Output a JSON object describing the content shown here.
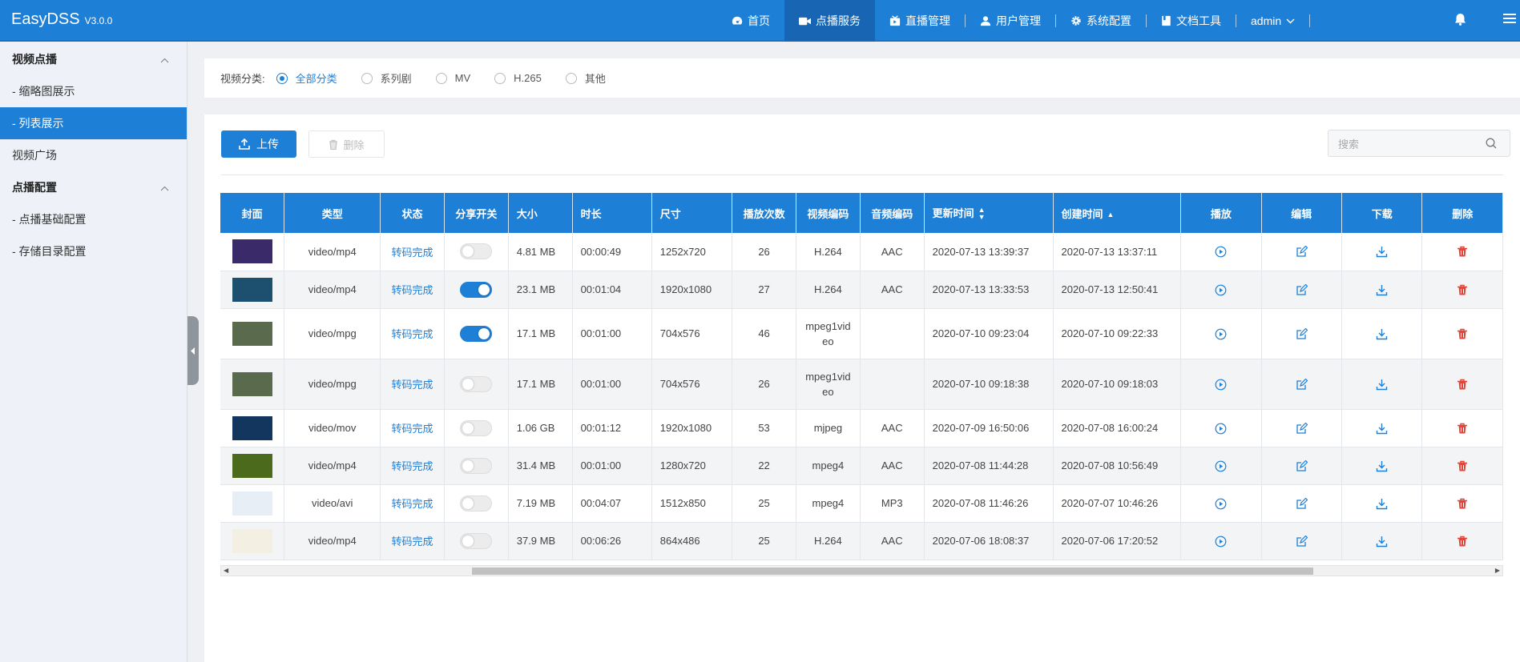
{
  "app": {
    "name": "EasyDSS",
    "version": "V3.0.0"
  },
  "nav": [
    {
      "label": "首页",
      "icon": "dashboard-icon",
      "active": false
    },
    {
      "label": "点播服务",
      "icon": "video-icon",
      "active": true
    },
    {
      "label": "直播管理",
      "icon": "live-icon",
      "active": false
    },
    {
      "label": "用户管理",
      "icon": "user-icon",
      "active": false
    },
    {
      "label": "系统配置",
      "icon": "gear-icon",
      "active": false
    },
    {
      "label": "文档工具",
      "icon": "book-icon",
      "active": false
    },
    {
      "label": "admin",
      "icon": "chevron-down-icon",
      "active": false
    }
  ],
  "sidebar": {
    "group1": "视频点播",
    "item1": "- 缩略图展示",
    "item2": "- 列表展示",
    "item3": "视频广场",
    "group2": "点播配置",
    "item4": "- 点播基础配置",
    "item5": "- 存储目录配置"
  },
  "filter": {
    "label": "视频分类:",
    "options": [
      "全部分类",
      "系列剧",
      "MV",
      "H.265",
      "其他"
    ],
    "selected": "全部分类"
  },
  "toolbar": {
    "upload": "上传",
    "delete": "删除",
    "search_placeholder": "搜索"
  },
  "table": {
    "headers": [
      "封面",
      "类型",
      "状态",
      "分享开关",
      "大小",
      "时长",
      "尺寸",
      "播放次数",
      "视频编码",
      "音频编码",
      "更新时间",
      "创建时间",
      "播放",
      "编辑",
      "下载",
      "删除"
    ],
    "rows": [
      {
        "type": "video/mp4",
        "status": "转码完成",
        "share": false,
        "size": "4.81 MB",
        "duration": "00:00:49",
        "dims": "1252x720",
        "plays": "26",
        "vcodec": "H.264",
        "acodec": "AAC",
        "updated": "2020-07-13 13:39:37",
        "created": "2020-07-13 13:37:11",
        "thumb": "#3a2a6a"
      },
      {
        "type": "video/mp4",
        "status": "转码完成",
        "share": true,
        "size": "23.1 MB",
        "duration": "00:01:04",
        "dims": "1920x1080",
        "plays": "27",
        "vcodec": "H.264",
        "acodec": "AAC",
        "updated": "2020-07-13 13:33:53",
        "created": "2020-07-13 12:50:41",
        "thumb": "#1d4f6e"
      },
      {
        "type": "video/mpg",
        "status": "转码完成",
        "share": true,
        "size": "17.1 MB",
        "duration": "00:01:00",
        "dims": "704x576",
        "plays": "46",
        "vcodec": "mpeg1video",
        "acodec": "",
        "updated": "2020-07-10 09:23:04",
        "created": "2020-07-10 09:22:33",
        "thumb": "#5a6a4c"
      },
      {
        "type": "video/mpg",
        "status": "转码完成",
        "share": false,
        "size": "17.1 MB",
        "duration": "00:01:00",
        "dims": "704x576",
        "plays": "26",
        "vcodec": "mpeg1video",
        "acodec": "",
        "updated": "2020-07-10 09:18:38",
        "created": "2020-07-10 09:18:03",
        "thumb": "#5a6a4c"
      },
      {
        "type": "video/mov",
        "status": "转码完成",
        "share": false,
        "size": "1.06 GB",
        "duration": "00:01:12",
        "dims": "1920x1080",
        "plays": "53",
        "vcodec": "mjpeg",
        "acodec": "AAC",
        "updated": "2020-07-09 16:50:06",
        "created": "2020-07-08 16:00:24",
        "thumb": "#12365e"
      },
      {
        "type": "video/mp4",
        "status": "转码完成",
        "share": false,
        "size": "31.4 MB",
        "duration": "00:01:00",
        "dims": "1280x720",
        "plays": "22",
        "vcodec": "mpeg4",
        "acodec": "AAC",
        "updated": "2020-07-08 11:44:28",
        "created": "2020-07-08 10:56:49",
        "thumb": "#4c6a1c"
      },
      {
        "type": "video/avi",
        "status": "转码完成",
        "share": false,
        "size": "7.19 MB",
        "duration": "00:04:07",
        "dims": "1512x850",
        "plays": "25",
        "vcodec": "mpeg4",
        "acodec": "MP3",
        "updated": "2020-07-08 11:46:26",
        "created": "2020-07-07 10:46:26",
        "thumb": "#e8eef6"
      },
      {
        "type": "video/mp4",
        "status": "转码完成",
        "share": false,
        "size": "37.9 MB",
        "duration": "00:06:26",
        "dims": "864x486",
        "plays": "25",
        "vcodec": "H.264",
        "acodec": "AAC",
        "updated": "2020-07-06 18:08:37",
        "created": "2020-07-06 17:20:52",
        "thumb": "#f3efe2"
      }
    ]
  },
  "colors": {
    "primary": "#1e7fd6",
    "delete": "#e0463a"
  }
}
